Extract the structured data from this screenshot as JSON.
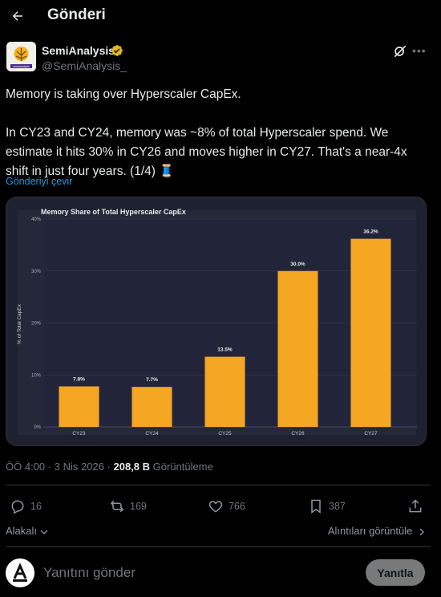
{
  "header": {
    "title": "Gönderi"
  },
  "author": {
    "name": "SemiAnalysis",
    "handle": "@SemiAnalysis_",
    "avatar_text": "semianalysis"
  },
  "tweet": {
    "text": "Memory is taking over Hyperscaler CapEx.\n\nIn CY23 and CY24, memory was ~8% of total Hyperscaler spend. We estimate it hits 30% in CY26 and moves higher in CY27. That's a near-4x shift in just four years. (1/4) 🧵",
    "translate_label": "Gönderiyi çevir"
  },
  "chart_data": {
    "type": "bar",
    "title": "Memory Share of Total Hyperscaler CapEx",
    "ylabel": "% of Total CapEx",
    "xlabel": "",
    "categories": [
      "CY23",
      "CY24",
      "CY25",
      "CY26",
      "CY27"
    ],
    "values": [
      7.8,
      7.7,
      13.5,
      30.0,
      36.2
    ],
    "data_labels": [
      "7.8%",
      "7.7%",
      "13.5%",
      "30.0%",
      "36.2%"
    ],
    "yticks": [
      0,
      10,
      20,
      30,
      40
    ],
    "ytick_labels": [
      "0%",
      "10%",
      "20%",
      "30%",
      "40%"
    ],
    "ylim": [
      0,
      40
    ],
    "grid": true,
    "bar_color": "#f5a623",
    "background": "#252838"
  },
  "meta": {
    "time": "ÖÖ 4:00",
    "date": "3 Nis 2026",
    "separator": "·",
    "views_count": "208,8 B",
    "views_label": "Görüntüleme"
  },
  "actions": {
    "replies": "16",
    "reposts": "169",
    "likes": "766",
    "bookmarks": "387"
  },
  "related": {
    "left": "Alakalı",
    "right": "Alıntıları görüntüle"
  },
  "reply": {
    "placeholder": "Yanıtını gönder",
    "button": "Yanıtla"
  },
  "colors": {
    "accent": "#1d9bf0",
    "muted": "#71767b",
    "verified": "#e2b719"
  }
}
